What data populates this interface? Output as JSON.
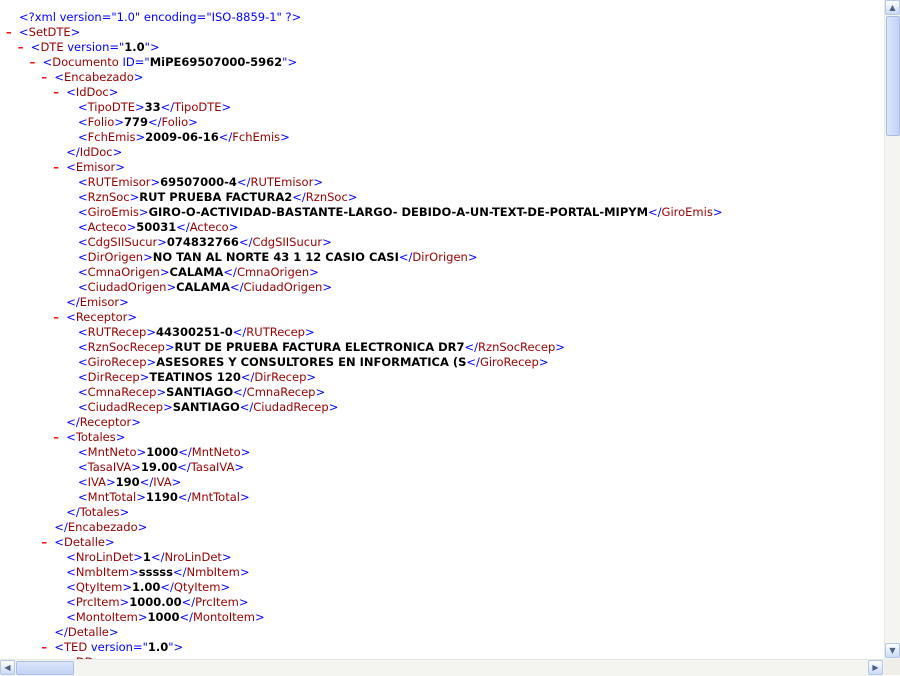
{
  "xml_lines": [
    {
      "i": 0,
      "m": false,
      "p": [
        [
          "pi",
          "<?xml version=\"1.0\" encoding=\"ISO-8859-1\" ?>"
        ]
      ]
    },
    {
      "i": 0,
      "m": true,
      "p": [
        [
          "b",
          "<"
        ],
        [
          "t",
          "SetDTE"
        ],
        [
          "b",
          ">"
        ]
      ]
    },
    {
      "i": 1,
      "m": true,
      "p": [
        [
          "b",
          "<"
        ],
        [
          "t",
          "DTE"
        ],
        [
          "b",
          " version=\""
        ],
        [
          "v",
          "1.0"
        ],
        [
          "b",
          "\">"
        ]
      ]
    },
    {
      "i": 2,
      "m": true,
      "p": [
        [
          "b",
          "<"
        ],
        [
          "t",
          "Documento"
        ],
        [
          "b",
          " ID=\""
        ],
        [
          "v",
          "MiPE69507000-5962"
        ],
        [
          "b",
          "\">"
        ]
      ]
    },
    {
      "i": 3,
      "m": true,
      "p": [
        [
          "b",
          "<"
        ],
        [
          "t",
          "Encabezado"
        ],
        [
          "b",
          ">"
        ]
      ]
    },
    {
      "i": 4,
      "m": true,
      "p": [
        [
          "b",
          "<"
        ],
        [
          "t",
          "IdDoc"
        ],
        [
          "b",
          ">"
        ]
      ]
    },
    {
      "i": 5,
      "m": false,
      "p": [
        [
          "b",
          "<"
        ],
        [
          "t",
          "TipoDTE"
        ],
        [
          "b",
          ">"
        ],
        [
          "v",
          "33"
        ],
        [
          "b",
          "</"
        ],
        [
          "t",
          "TipoDTE"
        ],
        [
          "b",
          ">"
        ]
      ]
    },
    {
      "i": 5,
      "m": false,
      "p": [
        [
          "b",
          "<"
        ],
        [
          "t",
          "Folio"
        ],
        [
          "b",
          ">"
        ],
        [
          "v",
          "779"
        ],
        [
          "b",
          "</"
        ],
        [
          "t",
          "Folio"
        ],
        [
          "b",
          ">"
        ]
      ]
    },
    {
      "i": 5,
      "m": false,
      "p": [
        [
          "b",
          "<"
        ],
        [
          "t",
          "FchEmis"
        ],
        [
          "b",
          ">"
        ],
        [
          "v",
          "2009-06-16"
        ],
        [
          "b",
          "</"
        ],
        [
          "t",
          "FchEmis"
        ],
        [
          "b",
          ">"
        ]
      ]
    },
    {
      "i": 4,
      "m": false,
      "p": [
        [
          "b",
          "</"
        ],
        [
          "t",
          "IdDoc"
        ],
        [
          "b",
          ">"
        ]
      ]
    },
    {
      "i": 4,
      "m": true,
      "p": [
        [
          "b",
          "<"
        ],
        [
          "t",
          "Emisor"
        ],
        [
          "b",
          ">"
        ]
      ]
    },
    {
      "i": 5,
      "m": false,
      "p": [
        [
          "b",
          "<"
        ],
        [
          "t",
          "RUTEmisor"
        ],
        [
          "b",
          ">"
        ],
        [
          "v",
          "69507000-4"
        ],
        [
          "b",
          "</"
        ],
        [
          "t",
          "RUTEmisor"
        ],
        [
          "b",
          ">"
        ]
      ]
    },
    {
      "i": 5,
      "m": false,
      "p": [
        [
          "b",
          "<"
        ],
        [
          "t",
          "RznSoc"
        ],
        [
          "b",
          ">"
        ],
        [
          "v",
          "RUT PRUEBA FACTURA2"
        ],
        [
          "b",
          "</"
        ],
        [
          "t",
          "RznSoc"
        ],
        [
          "b",
          ">"
        ]
      ]
    },
    {
      "i": 5,
      "m": false,
      "p": [
        [
          "b",
          "<"
        ],
        [
          "t",
          "GiroEmis"
        ],
        [
          "b",
          ">"
        ],
        [
          "v",
          "GIRO-O-ACTIVIDAD-BASTANTE-LARGO- DEBIDO-A-UN-TEXT-DE-PORTAL-MIPYM"
        ],
        [
          "b",
          "</"
        ],
        [
          "t",
          "GiroEmis"
        ],
        [
          "b",
          ">"
        ]
      ]
    },
    {
      "i": 5,
      "m": false,
      "p": [
        [
          "b",
          "<"
        ],
        [
          "t",
          "Acteco"
        ],
        [
          "b",
          ">"
        ],
        [
          "v",
          "50031"
        ],
        [
          "b",
          "</"
        ],
        [
          "t",
          "Acteco"
        ],
        [
          "b",
          ">"
        ]
      ]
    },
    {
      "i": 5,
      "m": false,
      "p": [
        [
          "b",
          "<"
        ],
        [
          "t",
          "CdgSIISucur"
        ],
        [
          "b",
          ">"
        ],
        [
          "v",
          "074832766"
        ],
        [
          "b",
          "</"
        ],
        [
          "t",
          "CdgSIISucur"
        ],
        [
          "b",
          ">"
        ]
      ]
    },
    {
      "i": 5,
      "m": false,
      "p": [
        [
          "b",
          "<"
        ],
        [
          "t",
          "DirOrigen"
        ],
        [
          "b",
          ">"
        ],
        [
          "v",
          "NO TAN AL NORTE 43 1 12 CASIO CASI"
        ],
        [
          "b",
          "</"
        ],
        [
          "t",
          "DirOrigen"
        ],
        [
          "b",
          ">"
        ]
      ]
    },
    {
      "i": 5,
      "m": false,
      "p": [
        [
          "b",
          "<"
        ],
        [
          "t",
          "CmnaOrigen"
        ],
        [
          "b",
          ">"
        ],
        [
          "v",
          "CALAMA"
        ],
        [
          "b",
          "</"
        ],
        [
          "t",
          "CmnaOrigen"
        ],
        [
          "b",
          ">"
        ]
      ]
    },
    {
      "i": 5,
      "m": false,
      "p": [
        [
          "b",
          "<"
        ],
        [
          "t",
          "CiudadOrigen"
        ],
        [
          "b",
          ">"
        ],
        [
          "v",
          "CALAMA"
        ],
        [
          "b",
          "</"
        ],
        [
          "t",
          "CiudadOrigen"
        ],
        [
          "b",
          ">"
        ]
      ]
    },
    {
      "i": 4,
      "m": false,
      "p": [
        [
          "b",
          "</"
        ],
        [
          "t",
          "Emisor"
        ],
        [
          "b",
          ">"
        ]
      ]
    },
    {
      "i": 4,
      "m": true,
      "p": [
        [
          "b",
          "<"
        ],
        [
          "t",
          "Receptor"
        ],
        [
          "b",
          ">"
        ]
      ]
    },
    {
      "i": 5,
      "m": false,
      "p": [
        [
          "b",
          "<"
        ],
        [
          "t",
          "RUTRecep"
        ],
        [
          "b",
          ">"
        ],
        [
          "v",
          "44300251-0"
        ],
        [
          "b",
          "</"
        ],
        [
          "t",
          "RUTRecep"
        ],
        [
          "b",
          ">"
        ]
      ]
    },
    {
      "i": 5,
      "m": false,
      "p": [
        [
          "b",
          "<"
        ],
        [
          "t",
          "RznSocRecep"
        ],
        [
          "b",
          ">"
        ],
        [
          "v",
          "RUT DE PRUEBA FACTURA ELECTRONICA DR7"
        ],
        [
          "b",
          "</"
        ],
        [
          "t",
          "RznSocRecep"
        ],
        [
          "b",
          ">"
        ]
      ]
    },
    {
      "i": 5,
      "m": false,
      "p": [
        [
          "b",
          "<"
        ],
        [
          "t",
          "GiroRecep"
        ],
        [
          "b",
          ">"
        ],
        [
          "v",
          "ASESORES Y CONSULTORES EN INFORMATICA (S"
        ],
        [
          "b",
          "</"
        ],
        [
          "t",
          "GiroRecep"
        ],
        [
          "b",
          ">"
        ]
      ]
    },
    {
      "i": 5,
      "m": false,
      "p": [
        [
          "b",
          "<"
        ],
        [
          "t",
          "DirRecep"
        ],
        [
          "b",
          ">"
        ],
        [
          "v",
          "TEATINOS 120"
        ],
        [
          "b",
          "</"
        ],
        [
          "t",
          "DirRecep"
        ],
        [
          "b",
          ">"
        ]
      ]
    },
    {
      "i": 5,
      "m": false,
      "p": [
        [
          "b",
          "<"
        ],
        [
          "t",
          "CmnaRecep"
        ],
        [
          "b",
          ">"
        ],
        [
          "v",
          "SANTIAGO"
        ],
        [
          "b",
          "</"
        ],
        [
          "t",
          "CmnaRecep"
        ],
        [
          "b",
          ">"
        ]
      ]
    },
    {
      "i": 5,
      "m": false,
      "p": [
        [
          "b",
          "<"
        ],
        [
          "t",
          "CiudadRecep"
        ],
        [
          "b",
          ">"
        ],
        [
          "v",
          "SANTIAGO"
        ],
        [
          "b",
          "</"
        ],
        [
          "t",
          "CiudadRecep"
        ],
        [
          "b",
          ">"
        ]
      ]
    },
    {
      "i": 4,
      "m": false,
      "p": [
        [
          "b",
          "</"
        ],
        [
          "t",
          "Receptor"
        ],
        [
          "b",
          ">"
        ]
      ]
    },
    {
      "i": 4,
      "m": true,
      "p": [
        [
          "b",
          "<"
        ],
        [
          "t",
          "Totales"
        ],
        [
          "b",
          ">"
        ]
      ]
    },
    {
      "i": 5,
      "m": false,
      "p": [
        [
          "b",
          "<"
        ],
        [
          "t",
          "MntNeto"
        ],
        [
          "b",
          ">"
        ],
        [
          "v",
          "1000"
        ],
        [
          "b",
          "</"
        ],
        [
          "t",
          "MntNeto"
        ],
        [
          "b",
          ">"
        ]
      ]
    },
    {
      "i": 5,
      "m": false,
      "p": [
        [
          "b",
          "<"
        ],
        [
          "t",
          "TasaIVA"
        ],
        [
          "b",
          ">"
        ],
        [
          "v",
          "19.00"
        ],
        [
          "b",
          "</"
        ],
        [
          "t",
          "TasaIVA"
        ],
        [
          "b",
          ">"
        ]
      ]
    },
    {
      "i": 5,
      "m": false,
      "p": [
        [
          "b",
          "<"
        ],
        [
          "t",
          "IVA"
        ],
        [
          "b",
          ">"
        ],
        [
          "v",
          "190"
        ],
        [
          "b",
          "</"
        ],
        [
          "t",
          "IVA"
        ],
        [
          "b",
          ">"
        ]
      ]
    },
    {
      "i": 5,
      "m": false,
      "p": [
        [
          "b",
          "<"
        ],
        [
          "t",
          "MntTotal"
        ],
        [
          "b",
          ">"
        ],
        [
          "v",
          "1190"
        ],
        [
          "b",
          "</"
        ],
        [
          "t",
          "MntTotal"
        ],
        [
          "b",
          ">"
        ]
      ]
    },
    {
      "i": 4,
      "m": false,
      "p": [
        [
          "b",
          "</"
        ],
        [
          "t",
          "Totales"
        ],
        [
          "b",
          ">"
        ]
      ]
    },
    {
      "i": 3,
      "m": false,
      "p": [
        [
          "b",
          "</"
        ],
        [
          "t",
          "Encabezado"
        ],
        [
          "b",
          ">"
        ]
      ]
    },
    {
      "i": 3,
      "m": true,
      "p": [
        [
          "b",
          "<"
        ],
        [
          "t",
          "Detalle"
        ],
        [
          "b",
          ">"
        ]
      ]
    },
    {
      "i": 4,
      "m": false,
      "p": [
        [
          "b",
          "<"
        ],
        [
          "t",
          "NroLinDet"
        ],
        [
          "b",
          ">"
        ],
        [
          "v",
          "1"
        ],
        [
          "b",
          "</"
        ],
        [
          "t",
          "NroLinDet"
        ],
        [
          "b",
          ">"
        ]
      ]
    },
    {
      "i": 4,
      "m": false,
      "p": [
        [
          "b",
          "<"
        ],
        [
          "t",
          "NmbItem"
        ],
        [
          "b",
          ">"
        ],
        [
          "v",
          "sssss"
        ],
        [
          "b",
          "</"
        ],
        [
          "t",
          "NmbItem"
        ],
        [
          "b",
          ">"
        ]
      ]
    },
    {
      "i": 4,
      "m": false,
      "p": [
        [
          "b",
          "<"
        ],
        [
          "t",
          "QtyItem"
        ],
        [
          "b",
          ">"
        ],
        [
          "v",
          "1.00"
        ],
        [
          "b",
          "</"
        ],
        [
          "t",
          "QtyItem"
        ],
        [
          "b",
          ">"
        ]
      ]
    },
    {
      "i": 4,
      "m": false,
      "p": [
        [
          "b",
          "<"
        ],
        [
          "t",
          "PrcItem"
        ],
        [
          "b",
          ">"
        ],
        [
          "v",
          "1000.00"
        ],
        [
          "b",
          "</"
        ],
        [
          "t",
          "PrcItem"
        ],
        [
          "b",
          ">"
        ]
      ]
    },
    {
      "i": 4,
      "m": false,
      "p": [
        [
          "b",
          "<"
        ],
        [
          "t",
          "MontoItem"
        ],
        [
          "b",
          ">"
        ],
        [
          "v",
          "1000"
        ],
        [
          "b",
          "</"
        ],
        [
          "t",
          "MontoItem"
        ],
        [
          "b",
          ">"
        ]
      ]
    },
    {
      "i": 3,
      "m": false,
      "p": [
        [
          "b",
          "</"
        ],
        [
          "t",
          "Detalle"
        ],
        [
          "b",
          ">"
        ]
      ]
    },
    {
      "i": 3,
      "m": true,
      "p": [
        [
          "b",
          "<"
        ],
        [
          "t",
          "TED"
        ],
        [
          "b",
          " version=\""
        ],
        [
          "v",
          "1.0"
        ],
        [
          "b",
          "\">"
        ]
      ]
    },
    {
      "i": 4,
      "m": false,
      "p": [
        [
          "b",
          "<"
        ],
        [
          "t",
          "DD"
        ],
        [
          "b",
          ">"
        ]
      ]
    }
  ],
  "collapse_glyph": "–",
  "icons": {
    "scroll_up": "triangle-up-icon",
    "scroll_down": "triangle-down-icon",
    "scroll_left": "triangle-left-icon",
    "scroll_right": "triangle-right-icon"
  },
  "glyphs": {
    "up": "▲",
    "down": "▼",
    "left": "◀",
    "right": "▶"
  }
}
